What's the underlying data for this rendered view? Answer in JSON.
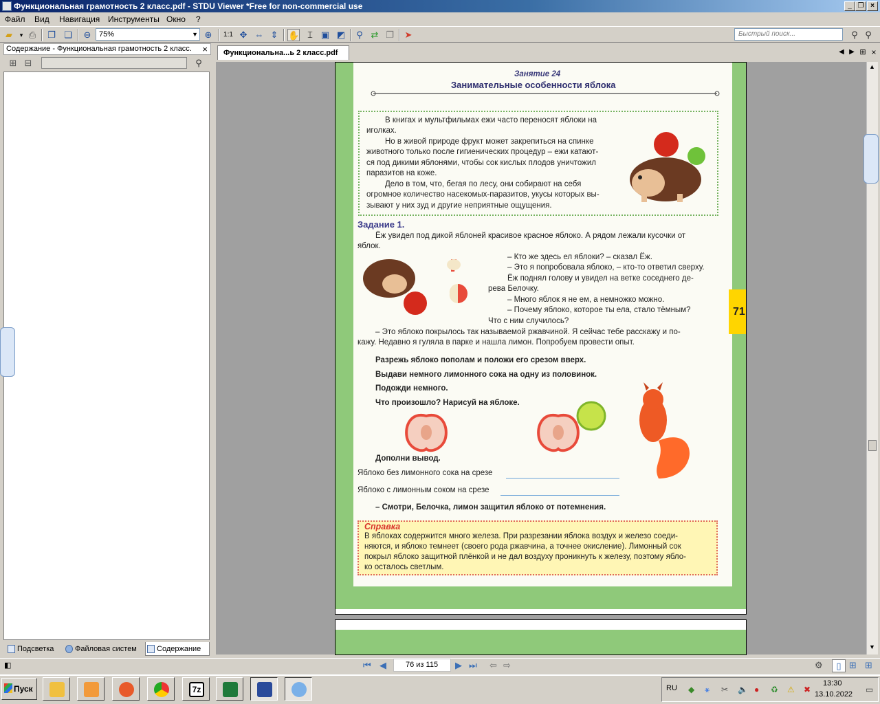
{
  "window": {
    "title": "Функциональная грамотность  2 класс.pdf - STDU Viewer *Free for non-commercial use",
    "minimize": "_",
    "restore": "❐",
    "close": "×"
  },
  "menu": [
    "Файл",
    "Вид",
    "Навигация",
    "Инструменты",
    "Окно",
    "?"
  ],
  "toolbar": {
    "zoom_value": "75%",
    "fit_label": "1:1",
    "search_placeholder": "Быстрый поиск..."
  },
  "left_panel": {
    "header": "Содержание - Функциональная грамотность  2 класс.",
    "close": "×",
    "tabs": [
      "Подсветка",
      "Файловая систем",
      "Содержание"
    ]
  },
  "document_tab": {
    "label": "Функциональна...ь 2 класс.pdf"
  },
  "page": {
    "lesson_number": "Занятие 24",
    "lesson_title": "Занимательные особенности яблока",
    "intro": [
      "В книгах и мультфильмах ежи часто переносят яблоки на",
      "иголках.",
      "Но в живой природе фрукт может закрепиться на спинке",
      "животного только после гигиенических процедур – ежи катают-",
      "ся под дикими яблонями, чтобы сок кислых плодов уничтожил",
      "паразитов на коже.",
      "Дело в том, что, бегая по лесу, они собирают на себя",
      "огромное количество насекомых-паразитов, укусы которых вы-",
      "зывают у них зуд и другие неприятные ощущения."
    ],
    "task_heading": "Задание 1.",
    "story": [
      "Ёж увидел под дикой яблоней красивое красное яблоко. А рядом лежали кусочки от",
      "яблок.",
      "– Кто же здесь ел яблоки? – сказал Ёж.",
      "– Это я попробовала яблоко, – кто-то ответил сверху.",
      "Ёж поднял голову и увидел на ветке соседнего де-",
      "рева Белочку.",
      "– Много яблок я не ем, а немножко можно.",
      "– Почему яблоко, которое ты ела, стало тёмным?",
      "Что с ним случилось?",
      "– Это яблоко покрылось так называемой ржавчиной. Я сейчас тебе расскажу и по-",
      "кажу. Недавно я гуляла в парке и нашла лимон. Попробуем провести опыт."
    ],
    "instructions": [
      "Разрежь яблоко пополам и положи его срезом вверх.",
      "Выдави немного лимонного сока на одну из половинок.",
      "Подожди немного.",
      "Что произошло? Нарисуй на яблоке."
    ],
    "conclusion_head": "Дополни вывод.",
    "fill1": "Яблоко без лимонного сока на срезе",
    "fill2": "Яблоко с лимонным соком на срезе",
    "closing": "– Смотри, Белочка, лимон защитил яблоко от потемнения.",
    "reference_title": "Справка",
    "reference": [
      "В яблоках содержится много железа. При разрезании яблока воздух и железо соеди-",
      "няются, и яблоко темнеет (своего рода ржавчина, а точнее окисление). Лимонный сок",
      "покрыл яблоко защитной плёнкой и не дал воздуху проникнуть к железу, поэтому ябло-",
      "ко осталось светлым."
    ],
    "page_tab_number": "71"
  },
  "navigation": {
    "page_indicator": "76 из 115"
  },
  "taskbar": {
    "start": "Пуск",
    "lang": "RU",
    "time": "13:30",
    "date": "13.10.2022"
  }
}
